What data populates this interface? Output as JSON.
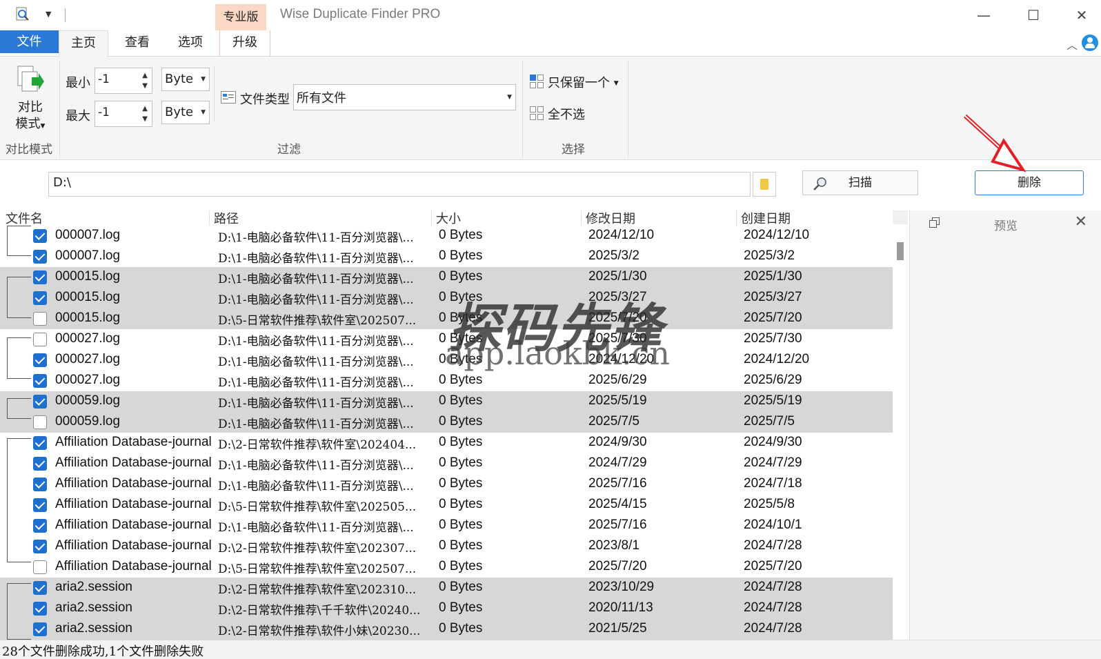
{
  "window": {
    "title": "Wise Duplicate Finder PRO",
    "pro_badge": "专业版",
    "minimize": "—",
    "maximize": "☐",
    "close": "✕"
  },
  "tabs": {
    "file": "文件",
    "home": "主页",
    "view": "查看",
    "options": "选项",
    "upgrade": "升级"
  },
  "ribbon": {
    "compare_mode_button": "对比\n模式",
    "compare_group_label": "对比模式",
    "min_label": "最小",
    "max_label": "最大",
    "min_value": "-1",
    "max_value": "-1",
    "min_unit": "Byte",
    "max_unit": "Byte",
    "file_type_label": "文件类型",
    "file_type_value": "所有文件",
    "filter_group_label": "过滤",
    "keep_one": "只保留一个",
    "select_none": "全不选",
    "select_group_label": "选择"
  },
  "pathbar": {
    "path": "D:\\",
    "scan_label": "扫描",
    "delete_label": "删除"
  },
  "columns": {
    "name": "文件名",
    "path": "路径",
    "size": "大小",
    "modified": "修改日期",
    "created": "创建日期"
  },
  "rows": [
    {
      "checked": true,
      "name": "000007.log",
      "path": "D:\\1-电脑必备软件\\11-百分浏览器\\...",
      "size": "0 Bytes",
      "modified": "2024/12/10",
      "created": "2024/12/10",
      "shaded": false
    },
    {
      "checked": true,
      "name": "000007.log",
      "path": "D:\\1-电脑必备软件\\11-百分浏览器\\...",
      "size": "0 Bytes",
      "modified": "2025/3/2",
      "created": "2025/3/2",
      "shaded": false
    },
    {
      "checked": true,
      "name": "000015.log",
      "path": "D:\\1-电脑必备软件\\11-百分浏览器\\...",
      "size": "0 Bytes",
      "modified": "2025/1/30",
      "created": "2025/1/30",
      "shaded": true
    },
    {
      "checked": true,
      "name": "000015.log",
      "path": "D:\\1-电脑必备软件\\11-百分浏览器\\...",
      "size": "0 Bytes",
      "modified": "2025/3/27",
      "created": "2025/3/27",
      "shaded": true
    },
    {
      "checked": false,
      "name": "000015.log",
      "path": "D:\\5-日常软件推荐\\软件室\\202507...",
      "size": "0 Bytes",
      "modified": "2025/7/20",
      "created": "2025/7/20",
      "shaded": true
    },
    {
      "checked": false,
      "name": "000027.log",
      "path": "D:\\1-电脑必备软件\\11-百分浏览器\\...",
      "size": "0 Bytes",
      "modified": "2025/7/30",
      "created": "2025/7/30",
      "shaded": false
    },
    {
      "checked": true,
      "name": "000027.log",
      "path": "D:\\1-电脑必备软件\\11-百分浏览器\\...",
      "size": "0 Bytes",
      "modified": "2024/12/20",
      "created": "2024/12/20",
      "shaded": false
    },
    {
      "checked": true,
      "name": "000027.log",
      "path": "D:\\1-电脑必备软件\\11-百分浏览器\\...",
      "size": "0 Bytes",
      "modified": "2025/6/29",
      "created": "2025/6/29",
      "shaded": false
    },
    {
      "checked": true,
      "name": "000059.log",
      "path": "D:\\1-电脑必备软件\\11-百分浏览器\\...",
      "size": "0 Bytes",
      "modified": "2025/5/19",
      "created": "2025/5/19",
      "shaded": true
    },
    {
      "checked": false,
      "name": "000059.log",
      "path": "D:\\1-电脑必备软件\\11-百分浏览器\\...",
      "size": "0 Bytes",
      "modified": "2025/7/5",
      "created": "2025/7/5",
      "shaded": true
    },
    {
      "checked": true,
      "name": "Affiliation Database-journal",
      "path": "D:\\2-日常软件推荐\\软件室\\202404...",
      "size": "0 Bytes",
      "modified": "2024/9/30",
      "created": "2024/9/30",
      "shaded": false
    },
    {
      "checked": true,
      "name": "Affiliation Database-journal",
      "path": "D:\\1-电脑必备软件\\11-百分浏览器\\...",
      "size": "0 Bytes",
      "modified": "2024/7/29",
      "created": "2024/7/29",
      "shaded": false
    },
    {
      "checked": true,
      "name": "Affiliation Database-journal",
      "path": "D:\\1-电脑必备软件\\11-百分浏览器\\...",
      "size": "0 Bytes",
      "modified": "2025/7/16",
      "created": "2024/7/18",
      "shaded": false
    },
    {
      "checked": true,
      "name": "Affiliation Database-journal",
      "path": "D:\\5-日常软件推荐\\软件室\\202505...",
      "size": "0 Bytes",
      "modified": "2025/4/15",
      "created": "2025/5/8",
      "shaded": false
    },
    {
      "checked": true,
      "name": "Affiliation Database-journal",
      "path": "D:\\1-电脑必备软件\\11-百分浏览器\\...",
      "size": "0 Bytes",
      "modified": "2025/7/16",
      "created": "2024/10/1",
      "shaded": false
    },
    {
      "checked": true,
      "name": "Affiliation Database-journal",
      "path": "D:\\2-日常软件推荐\\软件室\\202307...",
      "size": "0 Bytes",
      "modified": "2023/8/1",
      "created": "2024/7/28",
      "shaded": false
    },
    {
      "checked": false,
      "name": "Affiliation Database-journal",
      "path": "D:\\5-日常软件推荐\\软件室\\202507...",
      "size": "0 Bytes",
      "modified": "2025/7/20",
      "created": "2025/7/20",
      "shaded": false
    },
    {
      "checked": true,
      "name": "aria2.session",
      "path": "D:\\2-日常软件推荐\\软件室\\202310...",
      "size": "0 Bytes",
      "modified": "2023/10/29",
      "created": "2024/7/28",
      "shaded": true
    },
    {
      "checked": true,
      "name": "aria2.session",
      "path": "D:\\2-日常软件推荐\\千千软件\\20240...",
      "size": "0 Bytes",
      "modified": "2020/11/13",
      "created": "2024/7/28",
      "shaded": true
    },
    {
      "checked": true,
      "name": "aria2.session",
      "path": "D:\\2-日常软件推荐\\软件小妹\\20230...",
      "size": "0 Bytes",
      "modified": "2021/5/25",
      "created": "2024/7/28",
      "shaded": true
    }
  ],
  "preview": {
    "title": "预览",
    "close": "✕"
  },
  "status": "28个文件删除成功,1个文件删除失败",
  "watermark": {
    "line1": "探码先锋",
    "line2": "app.laokbk.cn"
  },
  "colors": {
    "accent": "#2b79d6",
    "checkbox": "#1f6fcf",
    "pro_badge_bg": "#f9d8c6",
    "shaded_row": "#d7d7d7",
    "annotation_arrow": "#e31e24"
  }
}
